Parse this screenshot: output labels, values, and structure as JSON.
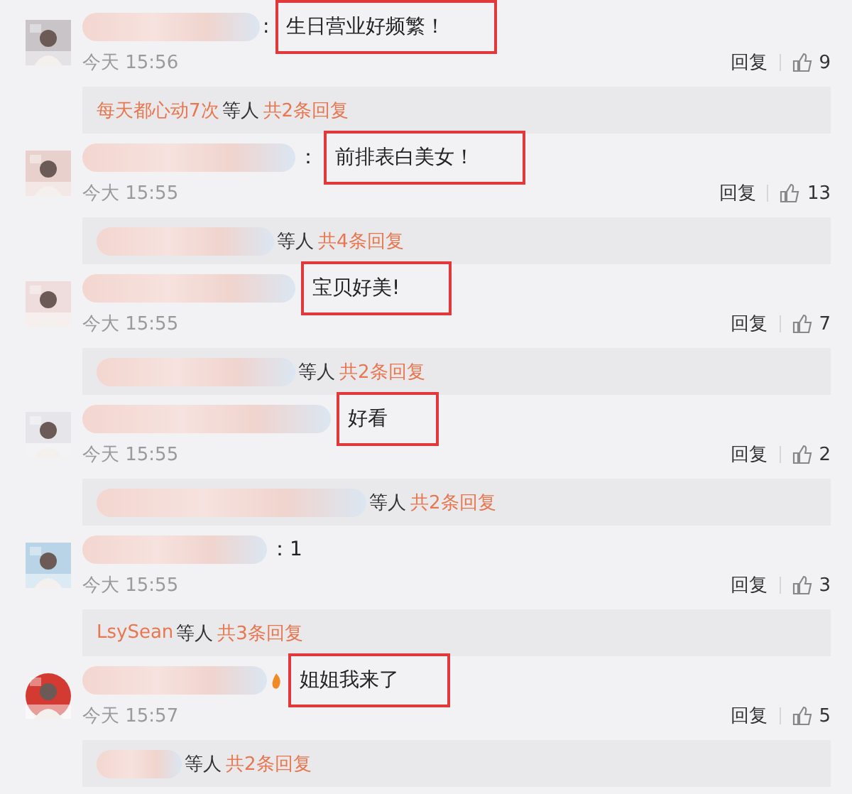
{
  "comments": [
    {
      "prefix": ":",
      "text": "生日营业好频繁！",
      "highlighted": true,
      "name_badge": false,
      "time": "今天 15:56",
      "reply": "回复",
      "likes": "9",
      "replies": {
        "by": "每天都心动7次",
        "etc": "等人",
        "count": "共2条回复"
      }
    },
    {
      "prefix": "：",
      "text": "前排表白美女！",
      "highlighted": true,
      "name_badge": false,
      "time": "今大 15:55",
      "reply": "回复",
      "likes": "13",
      "replies": {
        "etc": "等人",
        "count": "共4条回复"
      }
    },
    {
      "text": "宝贝好美!",
      "highlighted": true,
      "name_badge": false,
      "time": "今大 15:55",
      "reply": "回复",
      "likes": "7",
      "replies": {
        "etc": "等人",
        "count": "共2条回复"
      }
    },
    {
      "text": "好看",
      "highlighted": true,
      "name_badge": false,
      "time": "今天 15:55",
      "reply": "回复",
      "likes": "2",
      "replies": {
        "etc": "等人",
        "count": "共2条回复"
      }
    },
    {
      "prefix": "：",
      "text": "1",
      "highlighted": false,
      "name_badge": false,
      "time": "今大 15:55",
      "reply": "回复",
      "likes": "3",
      "replies": {
        "by": "LsySean",
        "etc": "等人",
        "count": "共3条回复"
      }
    },
    {
      "text": "姐姐我来了",
      "highlighted": true,
      "name_badge": true,
      "time": "今天 15:57",
      "reply": "回复",
      "likes": "5",
      "replies": {
        "etc": "等人",
        "count": "共2条回复"
      }
    }
  ]
}
